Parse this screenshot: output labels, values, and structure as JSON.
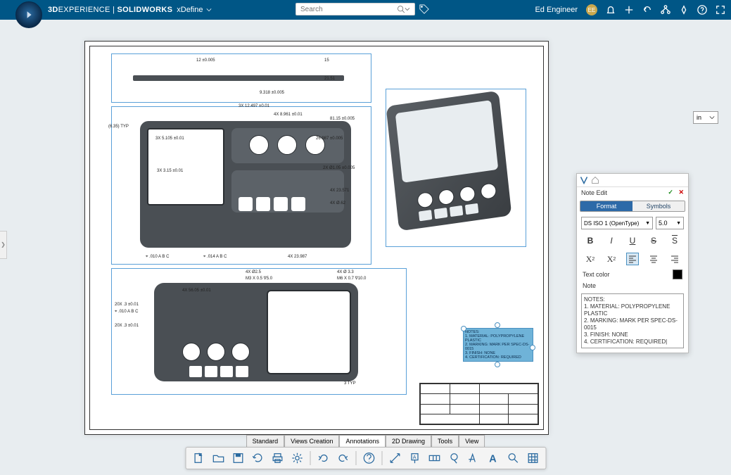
{
  "header": {
    "brand_prefix": "3D",
    "brand_bold": "EXPERIENCE",
    "brand_sep": " | ",
    "brand_app": "SOLIDWORKS",
    "app_mode": "xDefine",
    "search_placeholder": "Search",
    "user_name": "Ed Engineer",
    "user_initials": "EE"
  },
  "units": {
    "value": "in"
  },
  "note_edit": {
    "title": "Note Edit",
    "tab_format": "Format",
    "tab_symbols": "Symbols",
    "font": "DS ISO 1 (OpenType)",
    "size": "5.0",
    "label_textcolor": "Text color",
    "label_note": "Note",
    "note_text": "NOTES:\n1. MATERIAL: POLYPROPYLENE PLASTIC\n2. MARKING: MARK PER SPEC-DS-0015\n3. FINISH: NONE\n4. CERTIFICATION: REQUIRED|"
  },
  "drawing_note": {
    "l0": "NOTES:",
    "l1": "1. MATERIAL: POLYPROPYLENE PLASTIC",
    "l2": "2. MARKING: MARK PER SPEC-DS-0015",
    "l3": "3. FINISH: NONE",
    "l4": "4. CERTIFICATION: REQUIRED"
  },
  "bottom_tabs": {
    "t0": "Standard",
    "t1": "Views Creation",
    "t2": "Annotations",
    "t3": "2D Drawing",
    "t4": "Tools",
    "t5": "View"
  },
  "dims": {
    "d0": "12 ±0.005",
    "d1": "15",
    "d2": "21.51",
    "d3": "9.318 ±0.005",
    "d4": "(6.35) TYP",
    "d5": "3X  12.497 ±0.01",
    "d6": "4X  8.961 ±0.01",
    "d7": "81.15 ±0.005",
    "d8": "26.987 ±0.005",
    "d9": "3X  5.105 ±0.01",
    "d10": "3X  3.15 ±0.01",
    "d11": "2X  Ø1.05 ±0.005",
    "d12": "4X  23.571",
    "d13": "4X  Ø.62",
    "d14": "4X  23.987",
    "d15": "4X  Ø2.5",
    "d16": "M3 X 0.5  ∇5.0",
    "d17": "4X  Ø 3.3",
    "d18": "M6 X 0.7  ∇10.0",
    "d19": "20X  .3 ±0.01",
    "d20": "20X  .3 ±0.01",
    "d21": "3 TYP",
    "d22": "4X 56.05 ±0.01",
    "d23": "⌖ .010 A B C",
    "d24": "⌖ .014 A B C",
    "d25": "⌖ .010 A B C"
  }
}
